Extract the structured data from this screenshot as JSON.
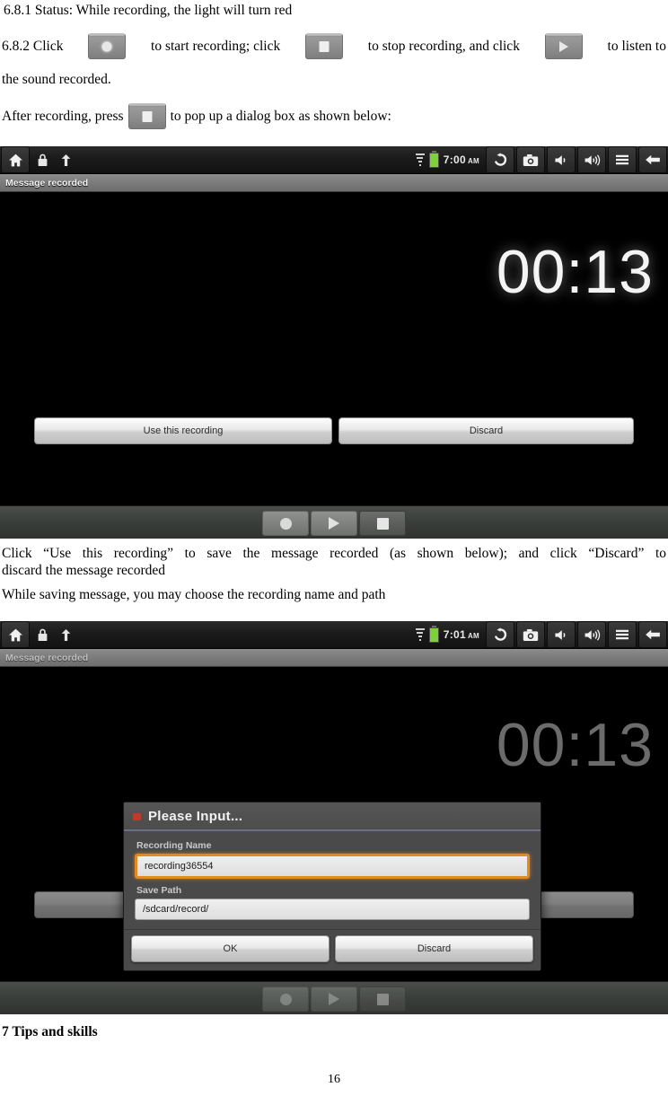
{
  "document": {
    "section_1_heading": "6.8.1 Status: While recording, the light will turn red",
    "para_2": {
      "before_record": "6.8.2 Click",
      "after_record": "to start recording; click",
      "after_stop": "to stop recording, and click",
      "after_play": "to listen to",
      "line2": "the sound recorded."
    },
    "para_3": {
      "before": "After recording, press",
      "after": "to pop up a dialog box as shown below:"
    },
    "para_4_line1": "Click “Use this recording” to save the message recorded (as shown below); and click “Discard” to",
    "para_4_line2": "discard the message recorded",
    "para_5": "While saving message, you may choose the recording name and path",
    "footer_heading": "7 Tips and skills",
    "page_number": "16"
  },
  "inline_icons": {
    "record": "record-circle-icon",
    "stop": "stop-square-icon",
    "play": "play-triangle-icon",
    "stop2": "stop-square-icon"
  },
  "screenshot_1": {
    "statusbar": {
      "home": "home-icon",
      "lock": "lock-icon",
      "eject": "eject-icon",
      "signal": "signal-icon",
      "battery": "battery-icon",
      "time": "7:00",
      "ampm": "AM",
      "rotate": "rotate-icon",
      "camera": "camera-icon",
      "volume_down": "volume-down-icon",
      "volume_up": "volume-up-icon",
      "menu": "menu-icon",
      "back": "back-arrow-icon"
    },
    "notification": "Message recorded",
    "timer": "00:13",
    "buttons": {
      "use": "Use this recording",
      "discard": "Discard"
    },
    "controls": {
      "record": "record-circle-icon",
      "play": "play-triangle-icon",
      "stop": "stop-square-icon"
    }
  },
  "screenshot_2": {
    "statusbar": {
      "home": "home-icon",
      "lock": "lock-icon",
      "eject": "eject-icon",
      "signal": "signal-icon",
      "battery": "battery-icon",
      "time": "7:01",
      "ampm": "AM",
      "rotate": "rotate-icon",
      "camera": "camera-icon",
      "volume_down": "volume-down-icon",
      "volume_up": "volume-up-icon",
      "menu": "menu-icon",
      "back": "back-arrow-icon"
    },
    "notification": "Message recorded",
    "timer": "00:13",
    "dialog": {
      "title": "Please Input...",
      "recording_name_label": "Recording Name",
      "recording_name_value": "recording36554",
      "save_path_label": "Save Path",
      "save_path_value": "/sdcard/record/",
      "ok": "OK",
      "discard": "Discard"
    },
    "controls": {
      "record": "record-circle-icon",
      "play": "play-triangle-icon",
      "stop": "stop-square-icon"
    }
  },
  "colors": {
    "accent_orange": "#e08a21",
    "battery_green": "#7fd03a",
    "dialog_dot_red": "#c0392b"
  }
}
